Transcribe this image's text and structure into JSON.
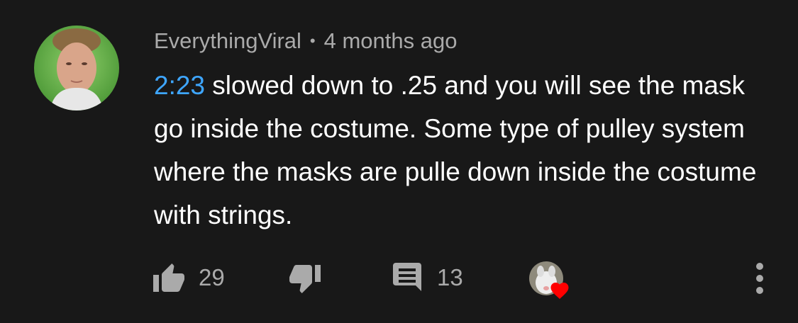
{
  "comment": {
    "author": "EverythingViral",
    "separator": "•",
    "age": "4 months ago",
    "timestamp_link": "2:23",
    "text": " slowed down to .25 and you will see the mask go inside the costume. Some type of pulley system where the masks are pulle down inside the costume with strings."
  },
  "actions": {
    "like_count": "29",
    "reply_count": "13"
  },
  "icons": {
    "like": "thumbs-up-icon",
    "dislike": "thumbs-down-icon",
    "reply": "comment-icon",
    "heart": "heart-icon",
    "more": "more-vertical-icon"
  },
  "colors": {
    "background": "#181818",
    "text": "#ffffff",
    "secondary_text": "#aaaaaa",
    "link": "#3ea6ff",
    "heart": "#ff0000"
  }
}
